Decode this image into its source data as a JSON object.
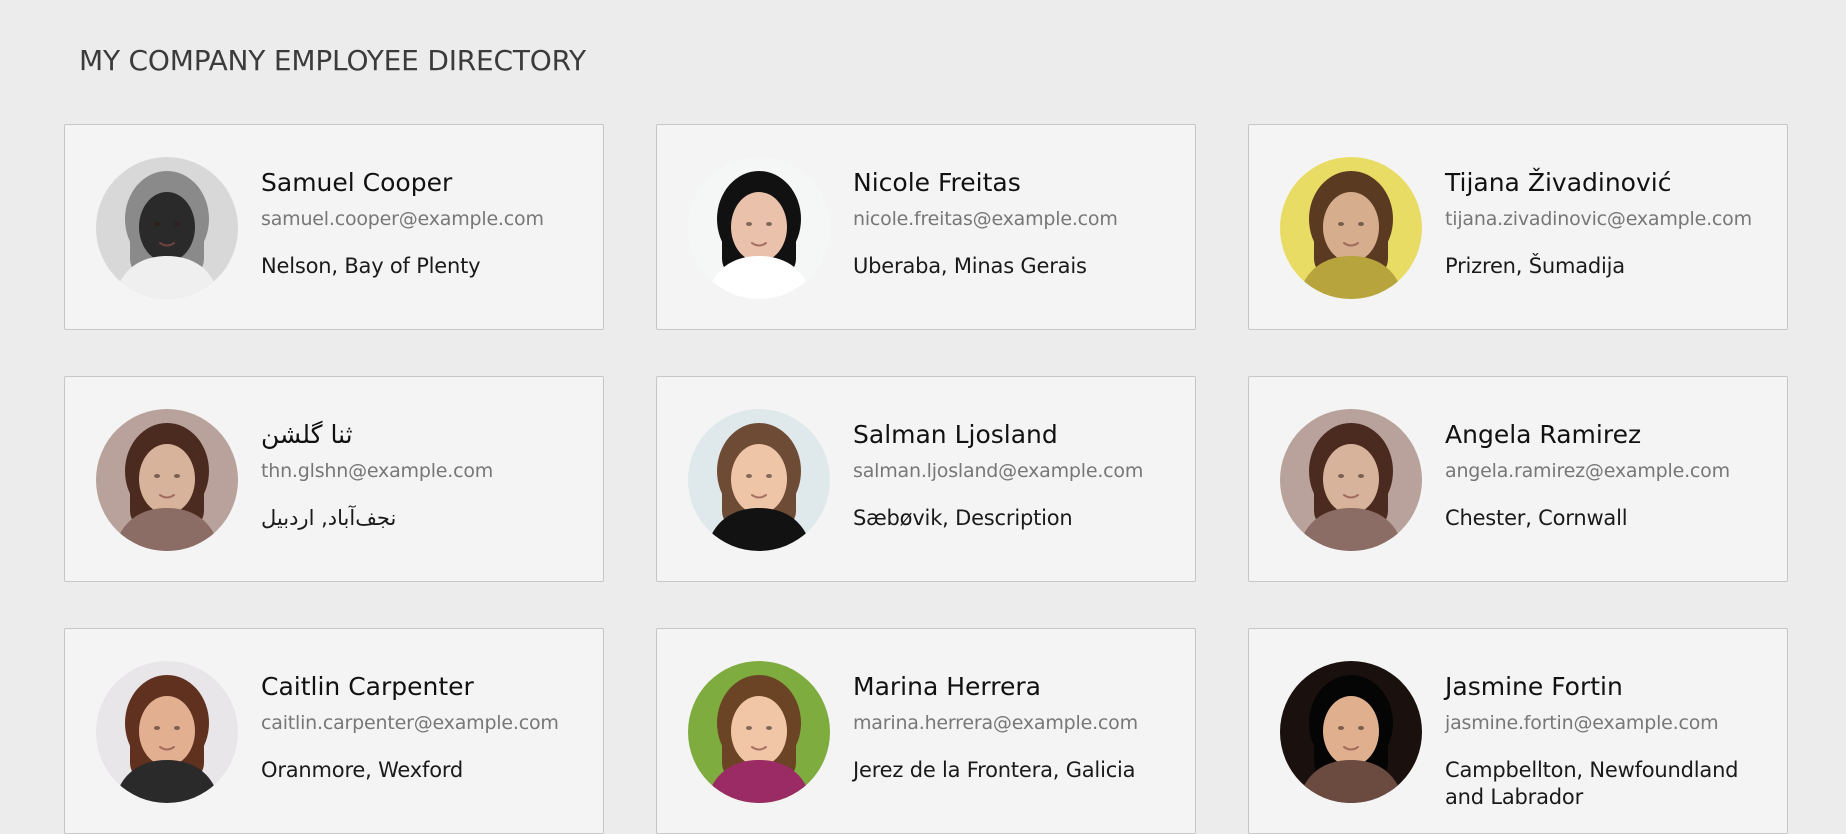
{
  "page": {
    "title": "MY COMPANY EMPLOYEE DIRECTORY"
  },
  "employees": [
    {
      "name": "Samuel Cooper",
      "email": "samuel.cooper@example.com",
      "location": "Nelson, Bay of Plenty",
      "avatar_colors": [
        "#d8d8d8",
        "#8a8a8a",
        "#2a2a2a",
        "#efefef"
      ]
    },
    {
      "name": "Nicole Freitas",
      "email": "nicole.freitas@example.com",
      "location": "Uberaba, Minas Gerais",
      "avatar_colors": [
        "#f5f7f6",
        "#111111",
        "#eac1aa",
        "#ffffff"
      ]
    },
    {
      "name": "Tijana Živadinović",
      "email": "tijana.zivadinovic@example.com",
      "location": "Prizren, Šumadija",
      "avatar_colors": [
        "#e9dc64",
        "#5a3a21",
        "#d6ad8d",
        "#b7a43d"
      ]
    },
    {
      "name": "ثنا گلشن",
      "email": "thn.glshn@example.com",
      "location": "نجف‌آباد, اردبیل",
      "avatar_colors": [
        "#b9a29b",
        "#4b2a20",
        "#d7b39b",
        "#8b6d65"
      ]
    },
    {
      "name": "Salman Ljosland",
      "email": "salman.ljosland@example.com",
      "location": "Sæbøvik, Description",
      "avatar_colors": [
        "#dfe8ea",
        "#6e4b35",
        "#efc5a8",
        "#121212"
      ]
    },
    {
      "name": "Angela Ramirez",
      "email": "angela.ramirez@example.com",
      "location": "Chester, Cornwall",
      "avatar_colors": [
        "#b9a29b",
        "#4b2a20",
        "#d7b39b",
        "#8b6d65"
      ]
    },
    {
      "name": "Caitlin Carpenter",
      "email": "caitlin.carpenter@example.com",
      "location": "Oranmore, Wexford",
      "avatar_colors": [
        "#e9e6ea",
        "#60311f",
        "#e2b090",
        "#2a2a2a"
      ]
    },
    {
      "name": "Marina Herrera",
      "email": "marina.herrera@example.com",
      "location": "Jerez de la Frontera, Galicia",
      "avatar_colors": [
        "#7fac3f",
        "#6b4426",
        "#f0c6a7",
        "#9b2b64"
      ]
    },
    {
      "name": "Jasmine Fortin",
      "email": "jasmine.fortin@example.com",
      "location": "Campbellton, Newfoundland and Labrador",
      "avatar_colors": [
        "#1a100e",
        "#050505",
        "#e0b08e",
        "#6b4a40"
      ]
    }
  ]
}
